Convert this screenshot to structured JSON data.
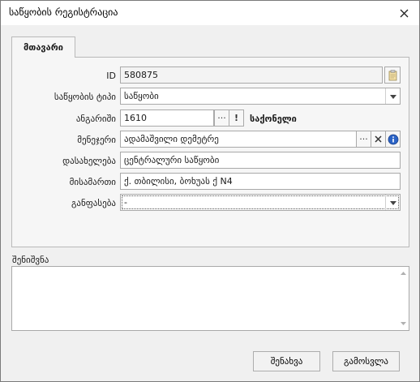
{
  "window": {
    "title": "საწყობის რეგისტრაცია"
  },
  "tabs": [
    {
      "label": "მთავარი",
      "active": true
    }
  ],
  "form": {
    "id": {
      "label": "ID",
      "value": "580875"
    },
    "warehouse_type": {
      "label": "საწყობის ტიპი",
      "value": "საწყობი"
    },
    "account": {
      "label": "ანგარიში",
      "value": "1610",
      "more_label": "···",
      "info_label": "!",
      "account_name": "საქონელი"
    },
    "manager": {
      "label": "მენეჯერი",
      "value": "ადამაშვილი დემეტრე",
      "more_label": "···"
    },
    "name": {
      "label": "დასახელება",
      "value": "ცენტრალური საწყობი"
    },
    "address": {
      "label": "მისამართი",
      "value": "ქ. თბილისი, ბოხუას ქ N4"
    },
    "placement": {
      "label": "განფასება",
      "value": "-"
    }
  },
  "notes": {
    "label": "შენიშვნა",
    "value": ""
  },
  "buttons": {
    "save": "შენახვა",
    "exit": "გამოსვლა"
  },
  "icons": {
    "close": "close-icon",
    "clipboard": "clipboard-icon",
    "clear": "clear-x-icon",
    "info": "info-icon",
    "dropdown": "chevron-down-icon"
  },
  "colors": {
    "info_blue": "#2b63c6",
    "border": "#a9a9a9",
    "background": "#f0f0f0"
  }
}
